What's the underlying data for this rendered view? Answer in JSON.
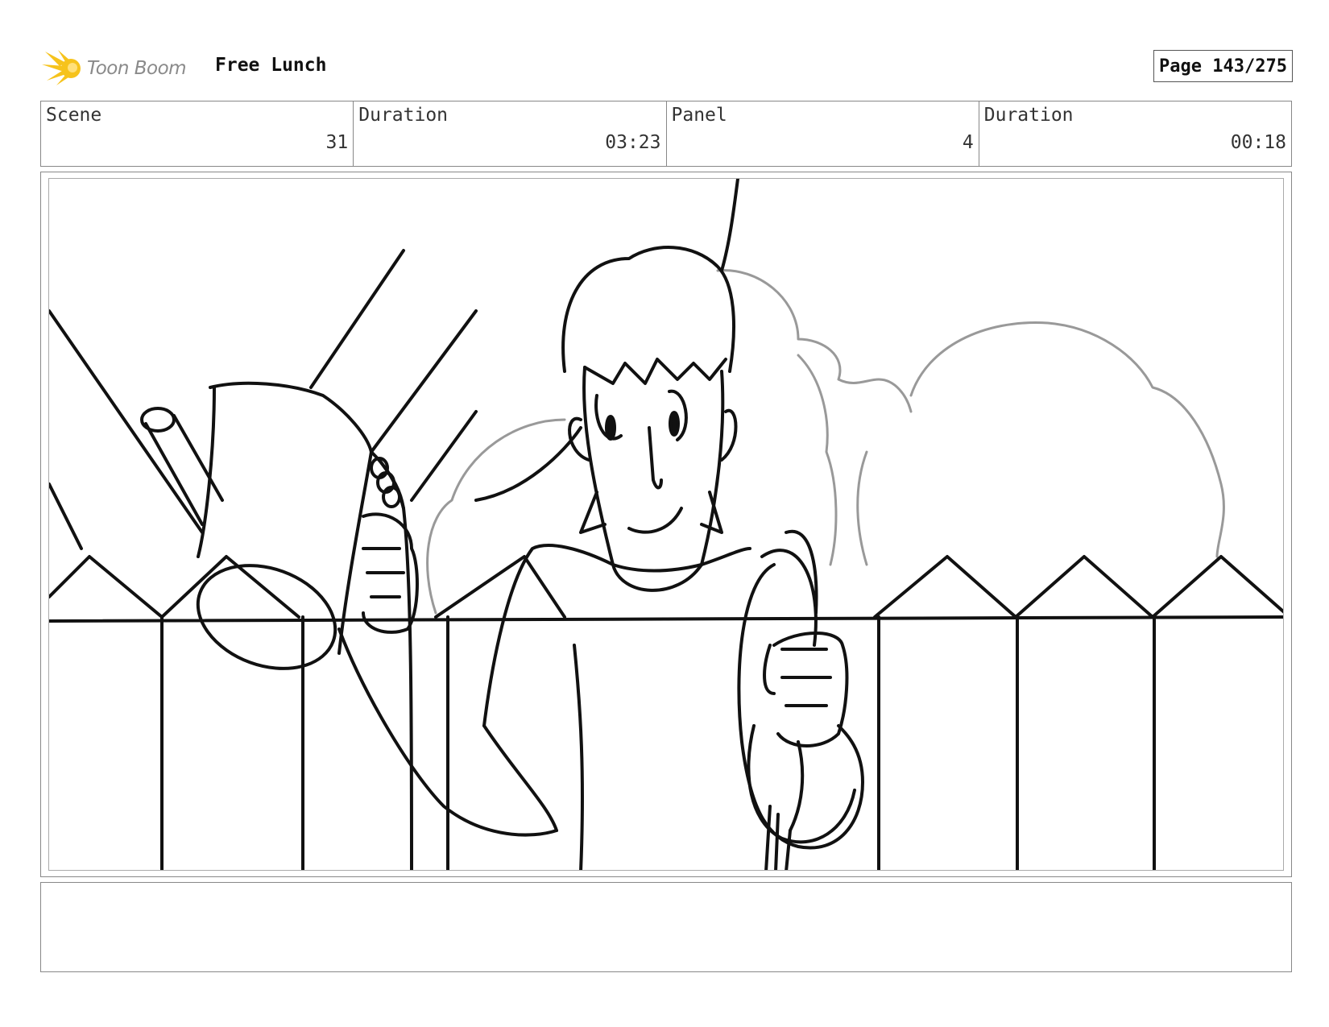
{
  "header": {
    "logo_text": "Toon Boom",
    "project_title": "Free Lunch",
    "page_label": "Page 143/275"
  },
  "info": {
    "scene_label": "Scene",
    "scene_value": "31",
    "scene_duration_label": "Duration",
    "scene_duration_value": "03:23",
    "panel_label": "Panel",
    "panel_value": "4",
    "panel_duration_label": "Duration",
    "panel_duration_value": "00:18"
  },
  "notes": {
    "text": ""
  },
  "colors": {
    "logo_yellow": "#f6c31c",
    "line": "#111111",
    "background_line": "#999999"
  }
}
